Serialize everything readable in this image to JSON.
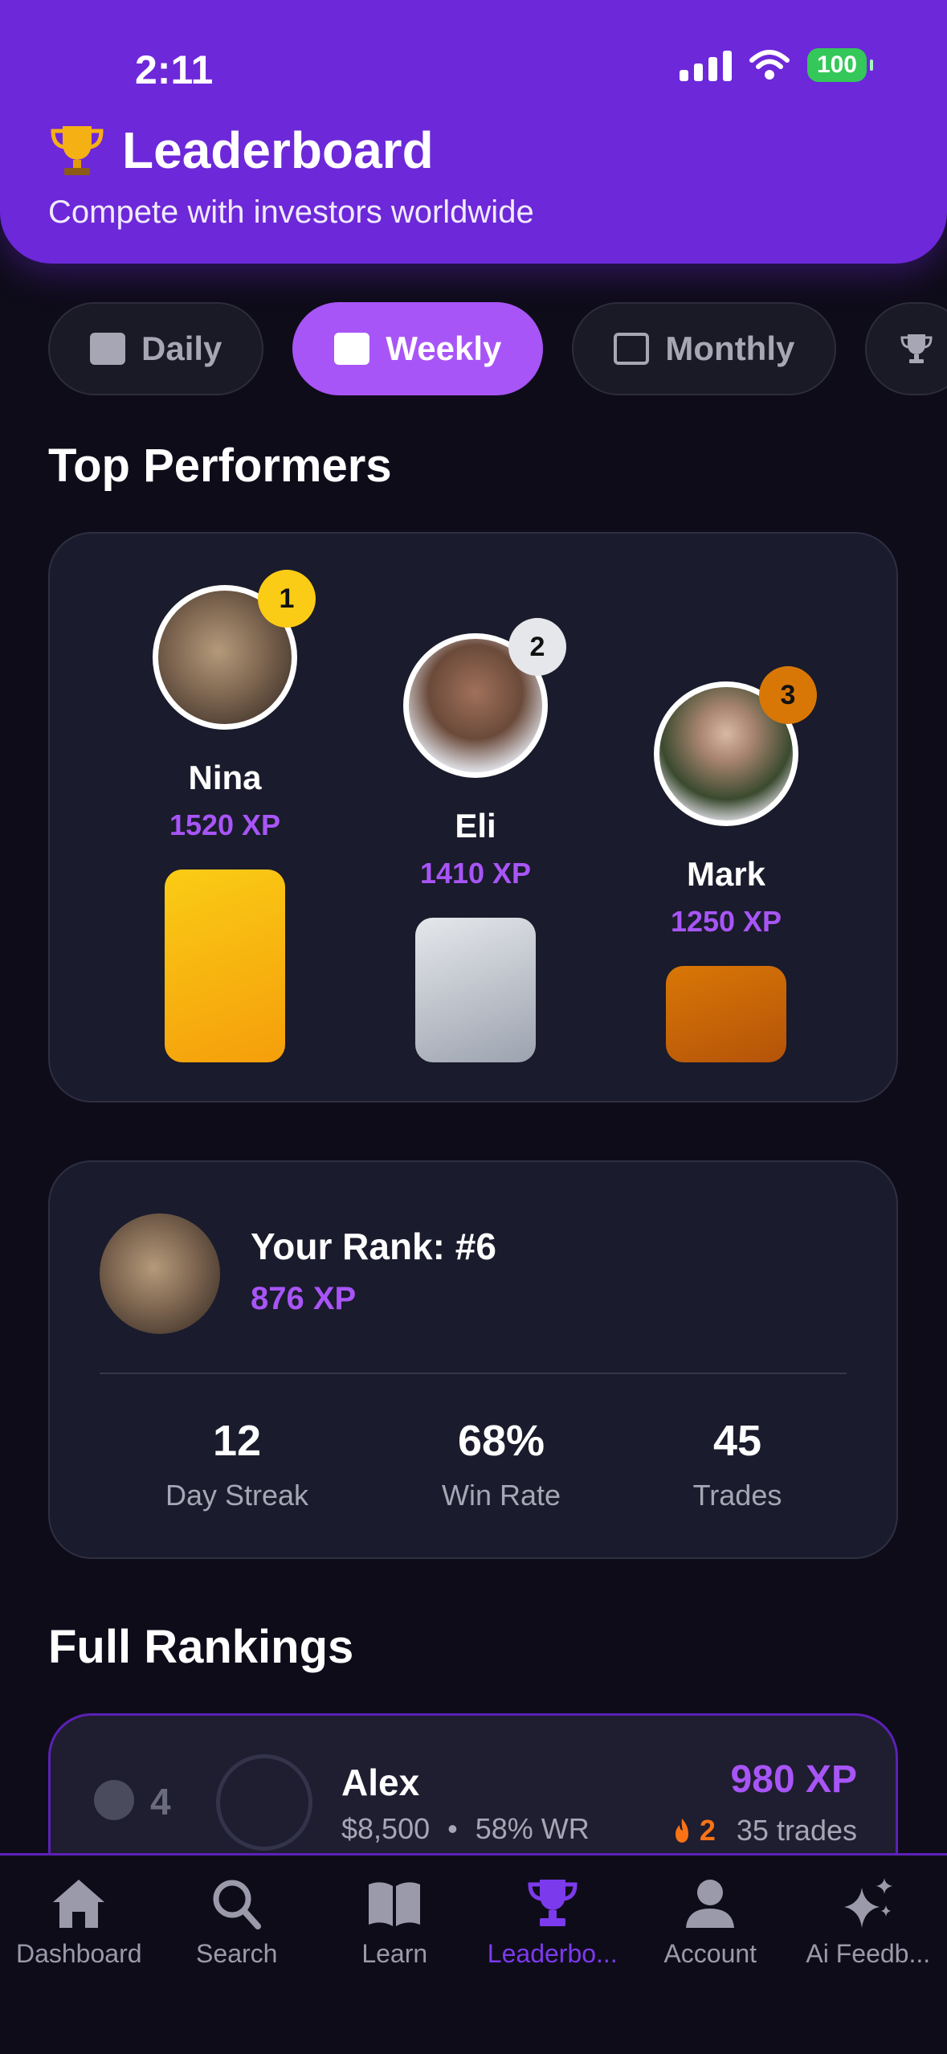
{
  "status_bar": {
    "time": "2:11",
    "battery": "100"
  },
  "header": {
    "title": "Leaderboard",
    "subtitle": "Compete with investors worldwide"
  },
  "tabs": [
    {
      "label": "Daily",
      "active": false
    },
    {
      "label": "Weekly",
      "active": true
    },
    {
      "label": "Monthly",
      "active": false
    }
  ],
  "top_performers": {
    "title": "Top Performers",
    "people": [
      {
        "rank": "1",
        "name": "Nina",
        "xp": "1520 XP"
      },
      {
        "rank": "2",
        "name": "Eli",
        "xp": "1410 XP"
      },
      {
        "rank": "3",
        "name": "Mark",
        "xp": "1250 XP"
      }
    ]
  },
  "your_rank": {
    "title": "Your Rank: #6",
    "xp": "876 XP",
    "stats": [
      {
        "value": "12",
        "label": "Day Streak"
      },
      {
        "value": "68%",
        "label": "Win Rate"
      },
      {
        "value": "45",
        "label": "Trades"
      }
    ]
  },
  "full_rankings": {
    "title": "Full Rankings",
    "rows": [
      {
        "rank": "4",
        "name": "Alex",
        "balance": "$8,500",
        "win_rate": "58% WR",
        "xp": "980 XP",
        "streak": "2",
        "trades": "35 trades"
      }
    ]
  },
  "nav": [
    {
      "label": "Dashboard",
      "icon": "home-icon"
    },
    {
      "label": "Search",
      "icon": "search-icon"
    },
    {
      "label": "Learn",
      "icon": "book-icon"
    },
    {
      "label": "Leaderbo...",
      "icon": "trophy-icon",
      "active": true
    },
    {
      "label": "Account",
      "icon": "person-icon"
    },
    {
      "label": "Ai Feedb...",
      "icon": "sparkles-icon"
    }
  ]
}
